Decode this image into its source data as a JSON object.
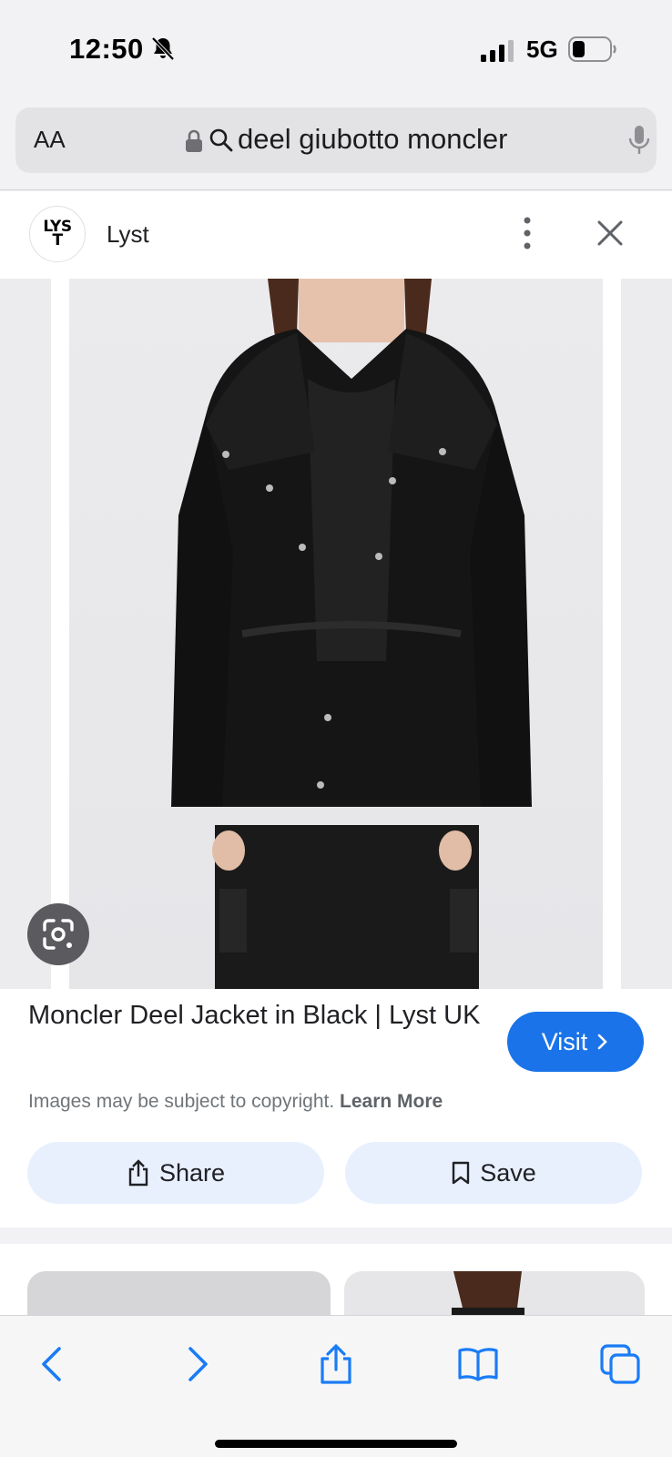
{
  "status_bar": {
    "time": "12:50",
    "network": "5G"
  },
  "address_bar": {
    "text_size_label": "AA",
    "query": "deel giubotto moncler"
  },
  "source": {
    "logo_text": "LYST",
    "name": "Lyst"
  },
  "result": {
    "title": "Moncler Deel Jacket in Black | Lyst UK",
    "visit_label": "Visit",
    "copyright_text": "Images may be subject to copyright.",
    "learn_more_label": "Learn More",
    "share_label": "Share",
    "save_label": "Save"
  },
  "colors": {
    "accent": "#1a73e8",
    "action_button_bg": "#e8f0fe",
    "safari_blue": "#1a7cf5"
  },
  "icons": {
    "status": [
      "bell-slash-icon",
      "signal-icon",
      "battery-icon"
    ],
    "address": [
      "lock-icon",
      "search-icon",
      "mic-icon"
    ],
    "toolbar": [
      "back-icon",
      "forward-icon",
      "share-icon",
      "bookmarks-icon",
      "tabs-icon"
    ]
  }
}
